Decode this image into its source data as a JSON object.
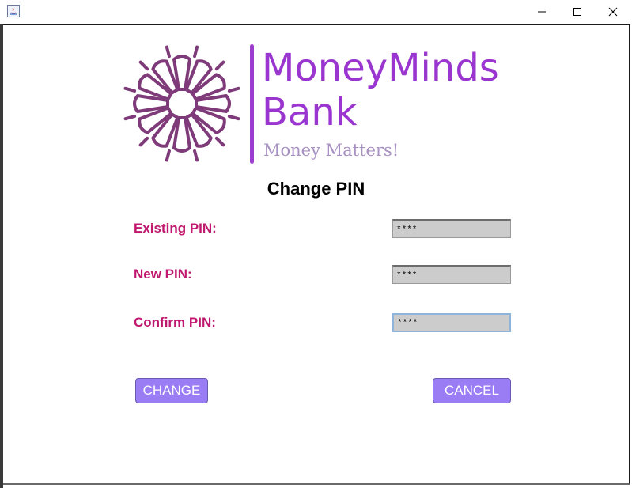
{
  "window": {
    "title": "",
    "icon": "java-icon",
    "controls": [
      "minimize-icon",
      "maximize-icon",
      "close-icon"
    ]
  },
  "brand": {
    "name_line1": "MoneyMinds",
    "name_line2": "Bank",
    "tagline": "Money Matters!",
    "colors": {
      "primary": "#9a35d0",
      "mark": "#7e3a79",
      "tagline": "#a790c2"
    }
  },
  "form": {
    "title": "Change PIN",
    "fields": [
      {
        "label": "Existing PIN:",
        "value": "****"
      },
      {
        "label": "New PIN:",
        "value": "****"
      },
      {
        "label": "Confirm PIN:",
        "value": "****"
      }
    ],
    "label_color": "#c0186f"
  },
  "buttons": {
    "change_label": "CHANGE",
    "cancel_label": "CANCEL",
    "color": "#9a7cf5"
  }
}
